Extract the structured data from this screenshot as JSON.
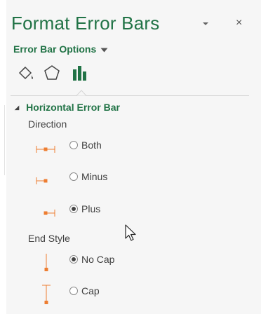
{
  "panel": {
    "title": "Format Error Bars",
    "options_label": "Error Bar Options",
    "close_glyph": "×",
    "tabs": [
      {
        "name": "fill-line",
        "icon": "paint-bucket-icon"
      },
      {
        "name": "effects",
        "icon": "pentagon-icon"
      },
      {
        "name": "error-bar-options",
        "icon": "bar-chart-icon",
        "selected": true
      }
    ]
  },
  "section": {
    "title": "Horizontal Error Bar",
    "direction": {
      "label": "Direction",
      "options": [
        {
          "label": "Both",
          "selected": false
        },
        {
          "label": "Minus",
          "selected": false
        },
        {
          "label": "Plus",
          "selected": true
        }
      ]
    },
    "end_style": {
      "label": "End Style",
      "options": [
        {
          "label": "No Cap",
          "selected": true
        },
        {
          "label": "Cap",
          "selected": false
        }
      ]
    }
  },
  "colors": {
    "accent": "#217346",
    "icon_orange": "#ed7d31"
  }
}
